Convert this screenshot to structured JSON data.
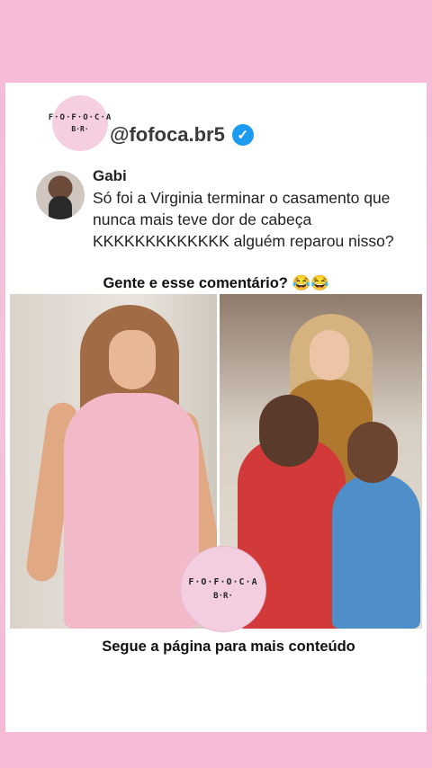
{
  "post": {
    "logo": {
      "line1": "F·O·F·O·C·A",
      "line2": "B·R·"
    },
    "handle": "@fofoca.br5",
    "verified_icon": "verified-check-icon",
    "comment": {
      "author": "Gabi",
      "text": "Só foi a Virginia terminar o casamento que nunca mais teve dor de cabeça KKKKKKKKKKKKK alguém reparou nisso?"
    },
    "headline": "Gente e esse comentário? 😂😂",
    "watermark": {
      "line1": "F·O·F·O·C·A",
      "line2": "B·R·"
    },
    "footer": "Segue a página para mais conteúdo"
  },
  "colors": {
    "background": "#f6b9d6",
    "card": "#ffffff",
    "verified": "#1d9bf0"
  }
}
